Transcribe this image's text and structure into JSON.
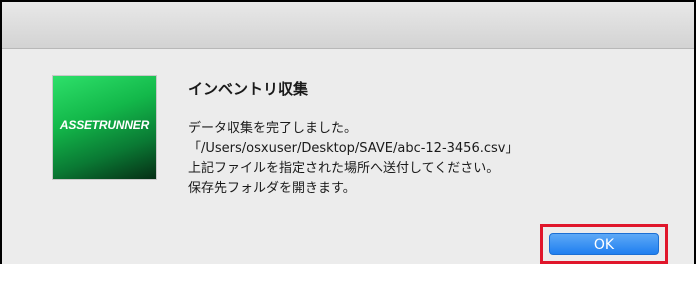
{
  "dialog": {
    "app_icon_text": "ASSETRUNNER",
    "title": "インベントリ収集",
    "message_lines": [
      "データ収集を完了しました。",
      "「/Users/osxuser/Desktop/SAVE/abc-12-3456.csv」",
      "上記ファイルを指定された場所へ送付してください。",
      "保存先フォルダを開きます。"
    ],
    "ok_label": "OK"
  },
  "colors": {
    "accent_button": "#1f7ff0",
    "highlight_border": "#e0162b",
    "app_icon_green": "#13b84a"
  }
}
